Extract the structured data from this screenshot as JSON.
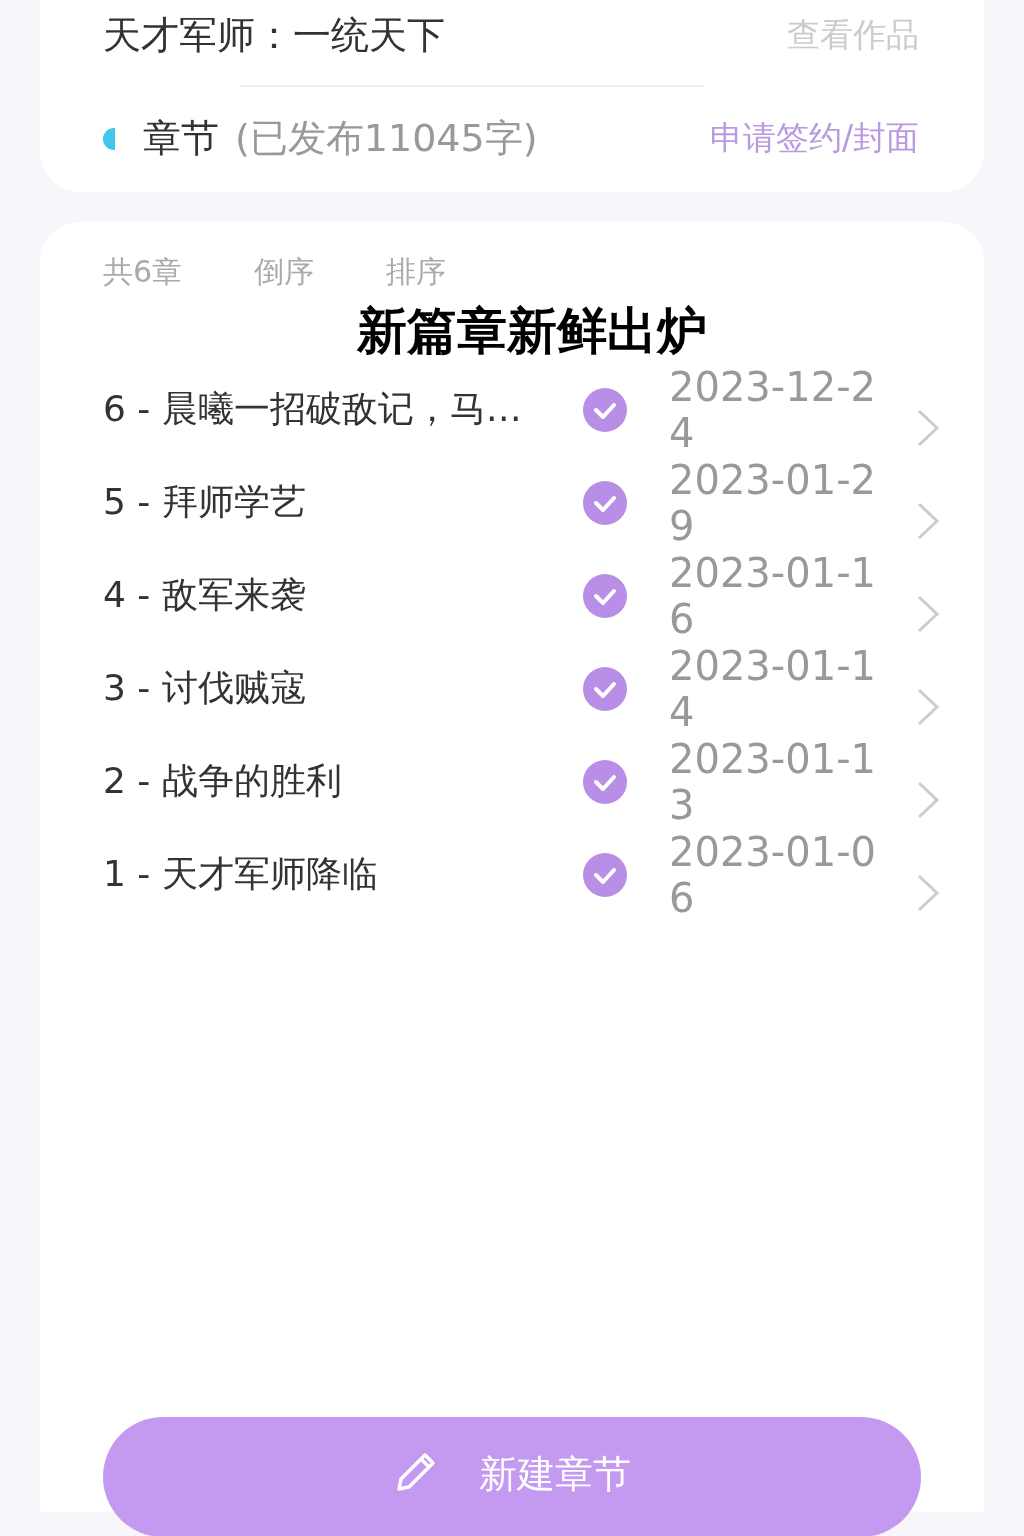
{
  "header": {
    "title": "天才军师：一统天下",
    "view_link": "查看作品",
    "section_label": "章节",
    "published_words": "(已发布11045字)",
    "sign_link": "申请签约/封面"
  },
  "toolbar": [
    "共6章",
    "倒序",
    "排序"
  ],
  "caption": "新篇章新鲜出炉",
  "chapters": [
    {
      "title": "6 - 晨曦一招破敌记，马…",
      "checked": true,
      "date": "2023-12-24"
    },
    {
      "title": "5 - 拜师学艺",
      "checked": true,
      "date": "2023-01-29"
    },
    {
      "title": "4 - 敌军来袭",
      "checked": true,
      "date": "2023-01-16"
    },
    {
      "title": "3 - 讨伐贼寇",
      "checked": true,
      "date": "2023-01-14"
    },
    {
      "title": "2 - 战争的胜利",
      "checked": true,
      "date": "2023-01-13"
    },
    {
      "title": "1 - 天才军师降临",
      "checked": true,
      "date": "2023-01-06"
    }
  ],
  "new_button": "新建章节"
}
